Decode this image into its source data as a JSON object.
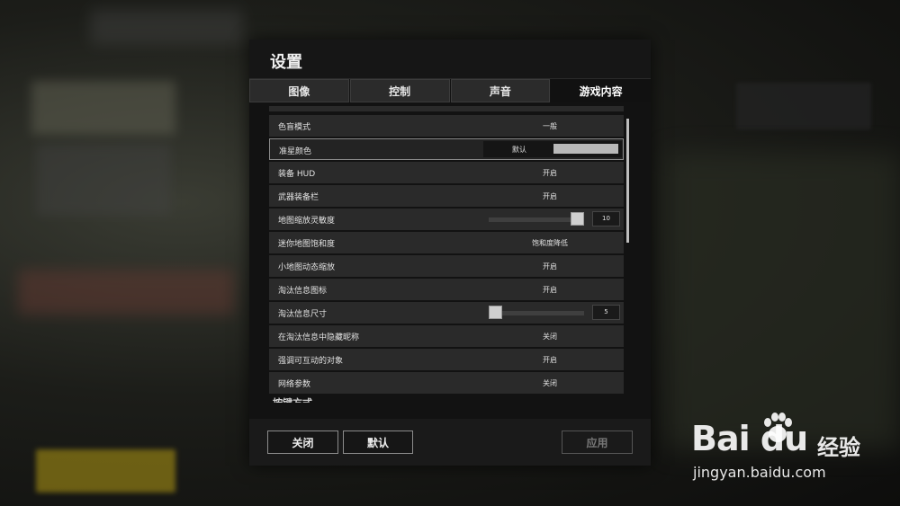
{
  "dialog": {
    "title": "设置"
  },
  "tabs": [
    {
      "label": "图像"
    },
    {
      "label": "控制"
    },
    {
      "label": "声音"
    },
    {
      "label": "游戏内容"
    }
  ],
  "settings": {
    "rows": [
      {
        "label": "色盲模式",
        "value": "一般"
      },
      {
        "label": "准星颜色",
        "value": "默认"
      },
      {
        "label": "装备 HUD",
        "value": "开启"
      },
      {
        "label": "武器装备栏",
        "value": "开启"
      },
      {
        "label": "地图缩放灵敏度",
        "value": "10"
      },
      {
        "label": "迷你地图饱和度",
        "value": "饱和度降低"
      },
      {
        "label": "小地图动态缩放",
        "value": "开启"
      },
      {
        "label": "淘汰信息图标",
        "value": "开启"
      },
      {
        "label": "淘汰信息尺寸",
        "value": "5"
      },
      {
        "label": "在淘汰信息中隐藏昵称",
        "value": "关闭"
      },
      {
        "label": "强调可互动的对象",
        "value": "开启"
      },
      {
        "label": "网络参数",
        "value": "关闭"
      }
    ],
    "next_section": "按键方式",
    "sliders": {
      "map_zoom_level": 1.0,
      "kill_feed_size_level": 0.0
    },
    "crosshair_color": "#b9b9b9"
  },
  "footer": {
    "close_label": "关闭",
    "default_label": "默认",
    "apply_label": "应用"
  },
  "watermark": {
    "brand": "Bai du",
    "text": "经验",
    "url": "jingyan.baidu.com"
  }
}
